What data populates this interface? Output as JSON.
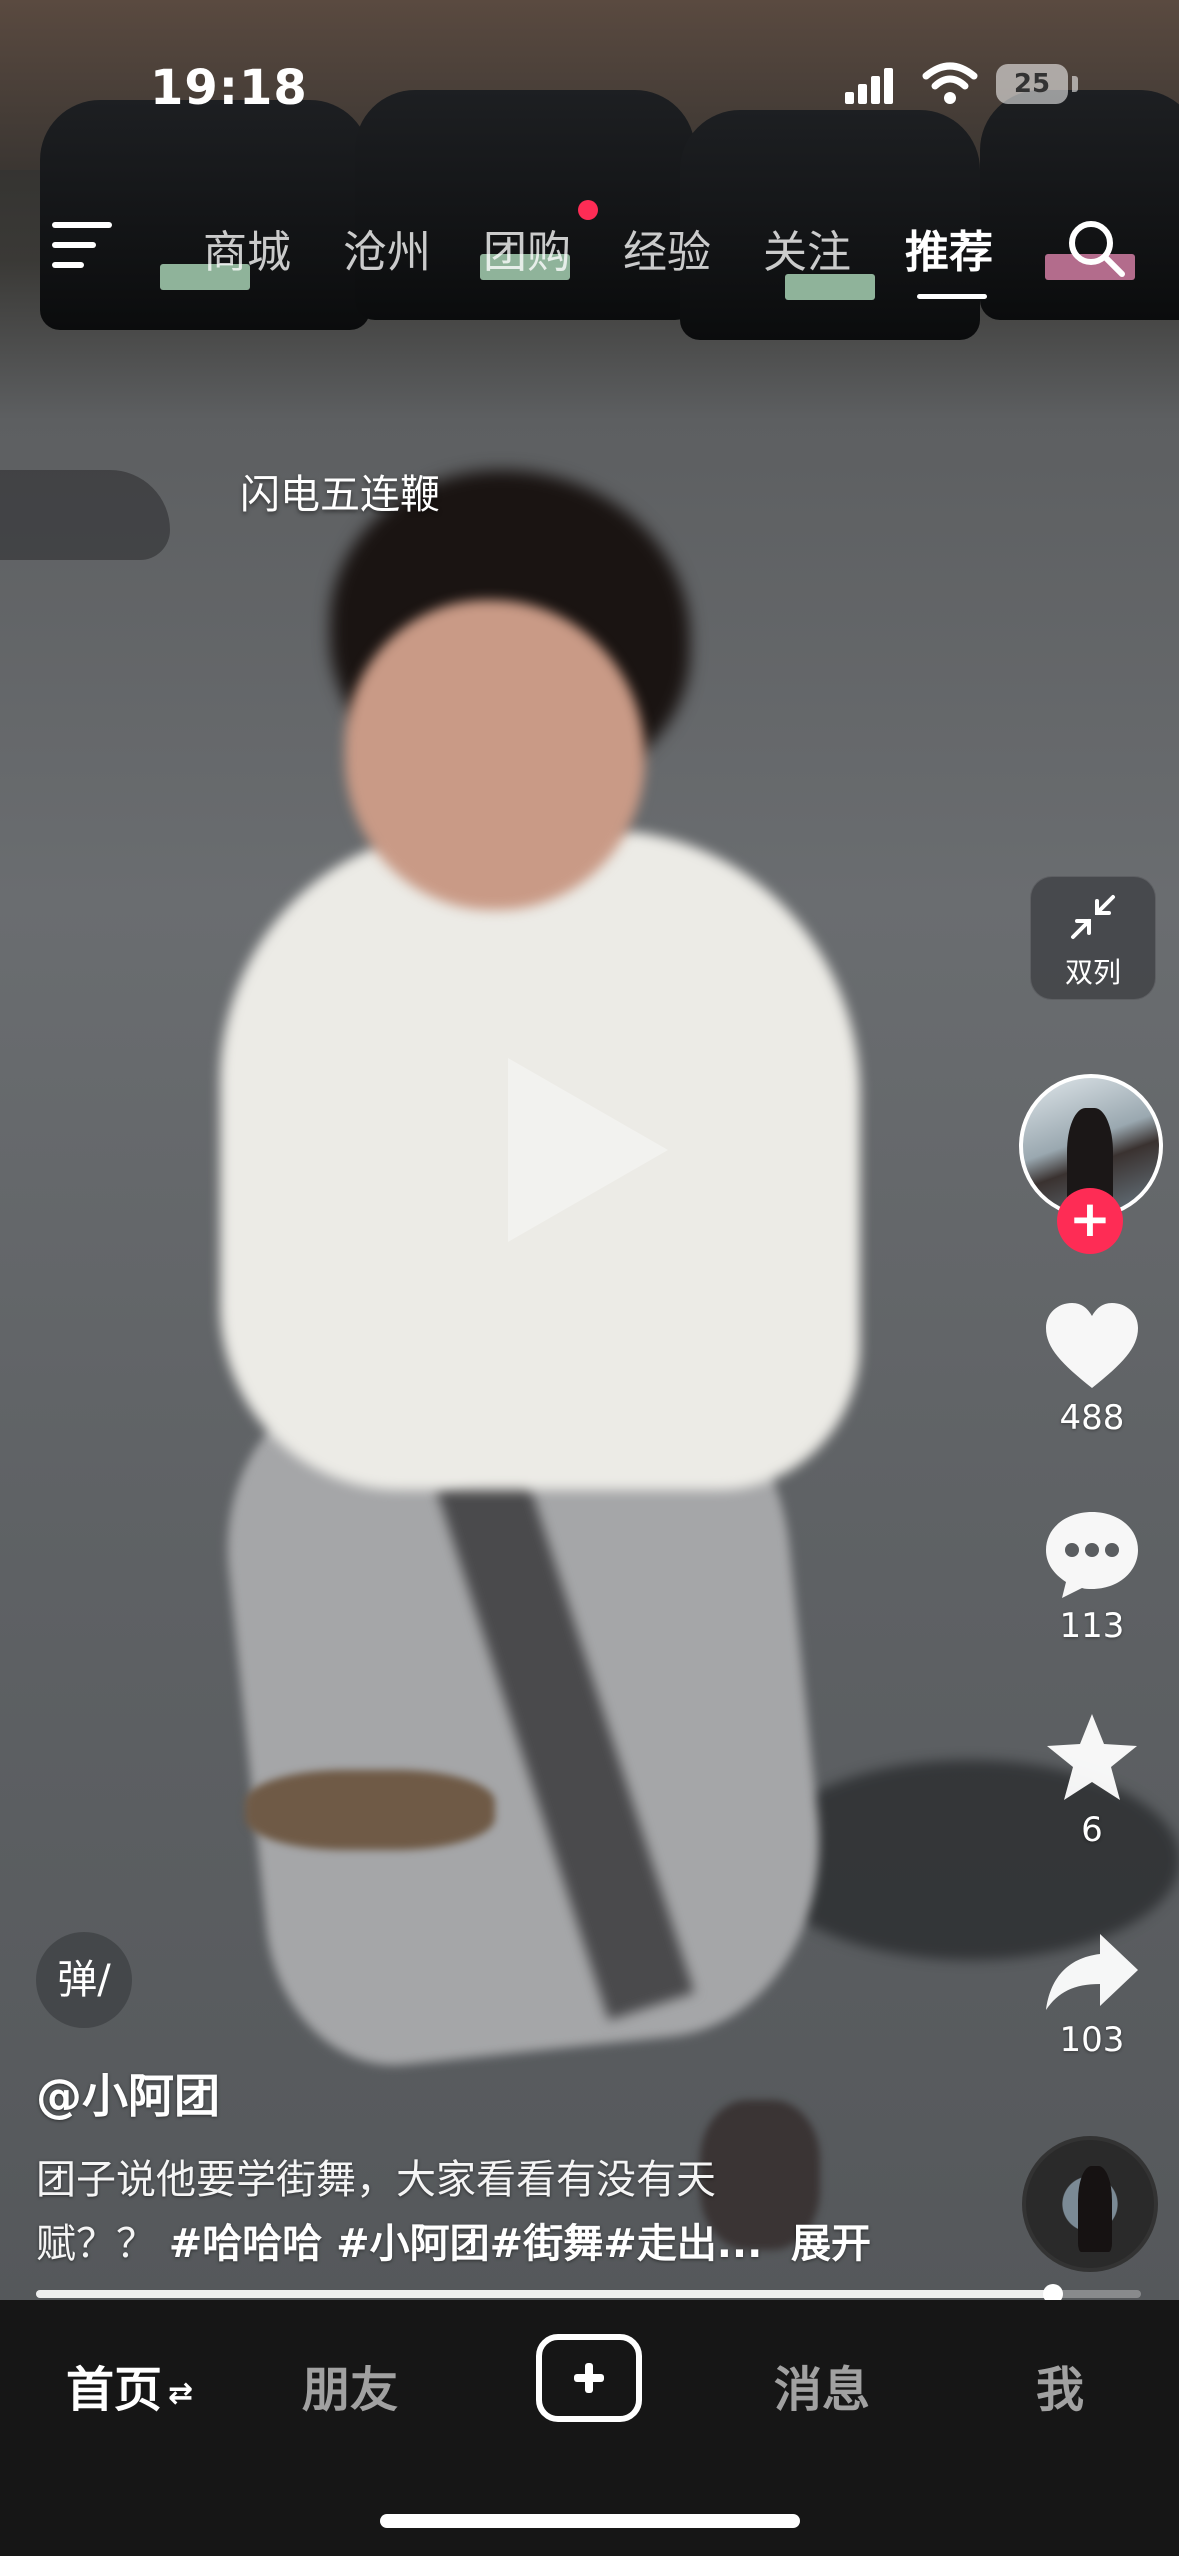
{
  "status_bar": {
    "time": "19:18",
    "battery": "25"
  },
  "top_nav": {
    "tabs": [
      {
        "label": "商城"
      },
      {
        "label": "沧州"
      },
      {
        "label": "团购"
      },
      {
        "label": "经验"
      },
      {
        "label": "关注"
      },
      {
        "label": "推荐"
      }
    ],
    "active_tab": "推荐",
    "dot_on_tab": "团购"
  },
  "video": {
    "overlay_text": "闪电五连鞭",
    "progress": 0.92
  },
  "right_rail": {
    "dual_column_label": "双列",
    "likes": "488",
    "comments": "113",
    "favorites": "6",
    "shares": "103"
  },
  "post": {
    "danmu_label": "弹/",
    "author": "@小阿团",
    "desc_line1": "团子说他要学街舞，大家看看有没有天",
    "desc_line2_prefix": "赋？？",
    "hashtags": "#哈哈哈 #小阿团#街舞#走出...",
    "expand_label": "展开"
  },
  "bottom_tabs": {
    "home": "首页",
    "home_switch_glyph": "⇄",
    "friends": "朋友",
    "messages": "消息",
    "me": "我"
  },
  "colors": {
    "accent": "#fe2c55",
    "tabbar_bg": "#161616"
  }
}
